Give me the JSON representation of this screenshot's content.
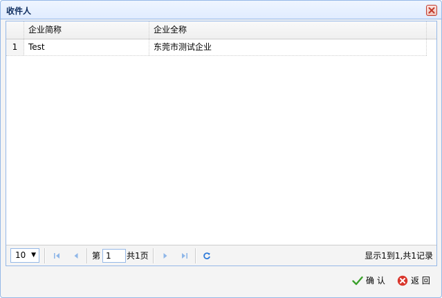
{
  "dialog": {
    "title": "收件人",
    "close_icon": "close-icon"
  },
  "grid": {
    "columns": [
      "企业简称",
      "企业全称"
    ],
    "rows": [
      {
        "num": "1",
        "short_name": "Test",
        "full_name": "东莞市测试企业"
      }
    ]
  },
  "pager": {
    "page_size": "10",
    "page_prefix": "第",
    "page_value": "1",
    "page_suffix": "共1页",
    "info": "显示1到1,共1记录"
  },
  "buttons": {
    "ok": "确 认",
    "back": "返 回"
  },
  "colors": {
    "accent": "#95b8e7",
    "title": "#0e2d5f",
    "ok_icon": "#3aa02b",
    "back_icon": "#d9362c"
  }
}
